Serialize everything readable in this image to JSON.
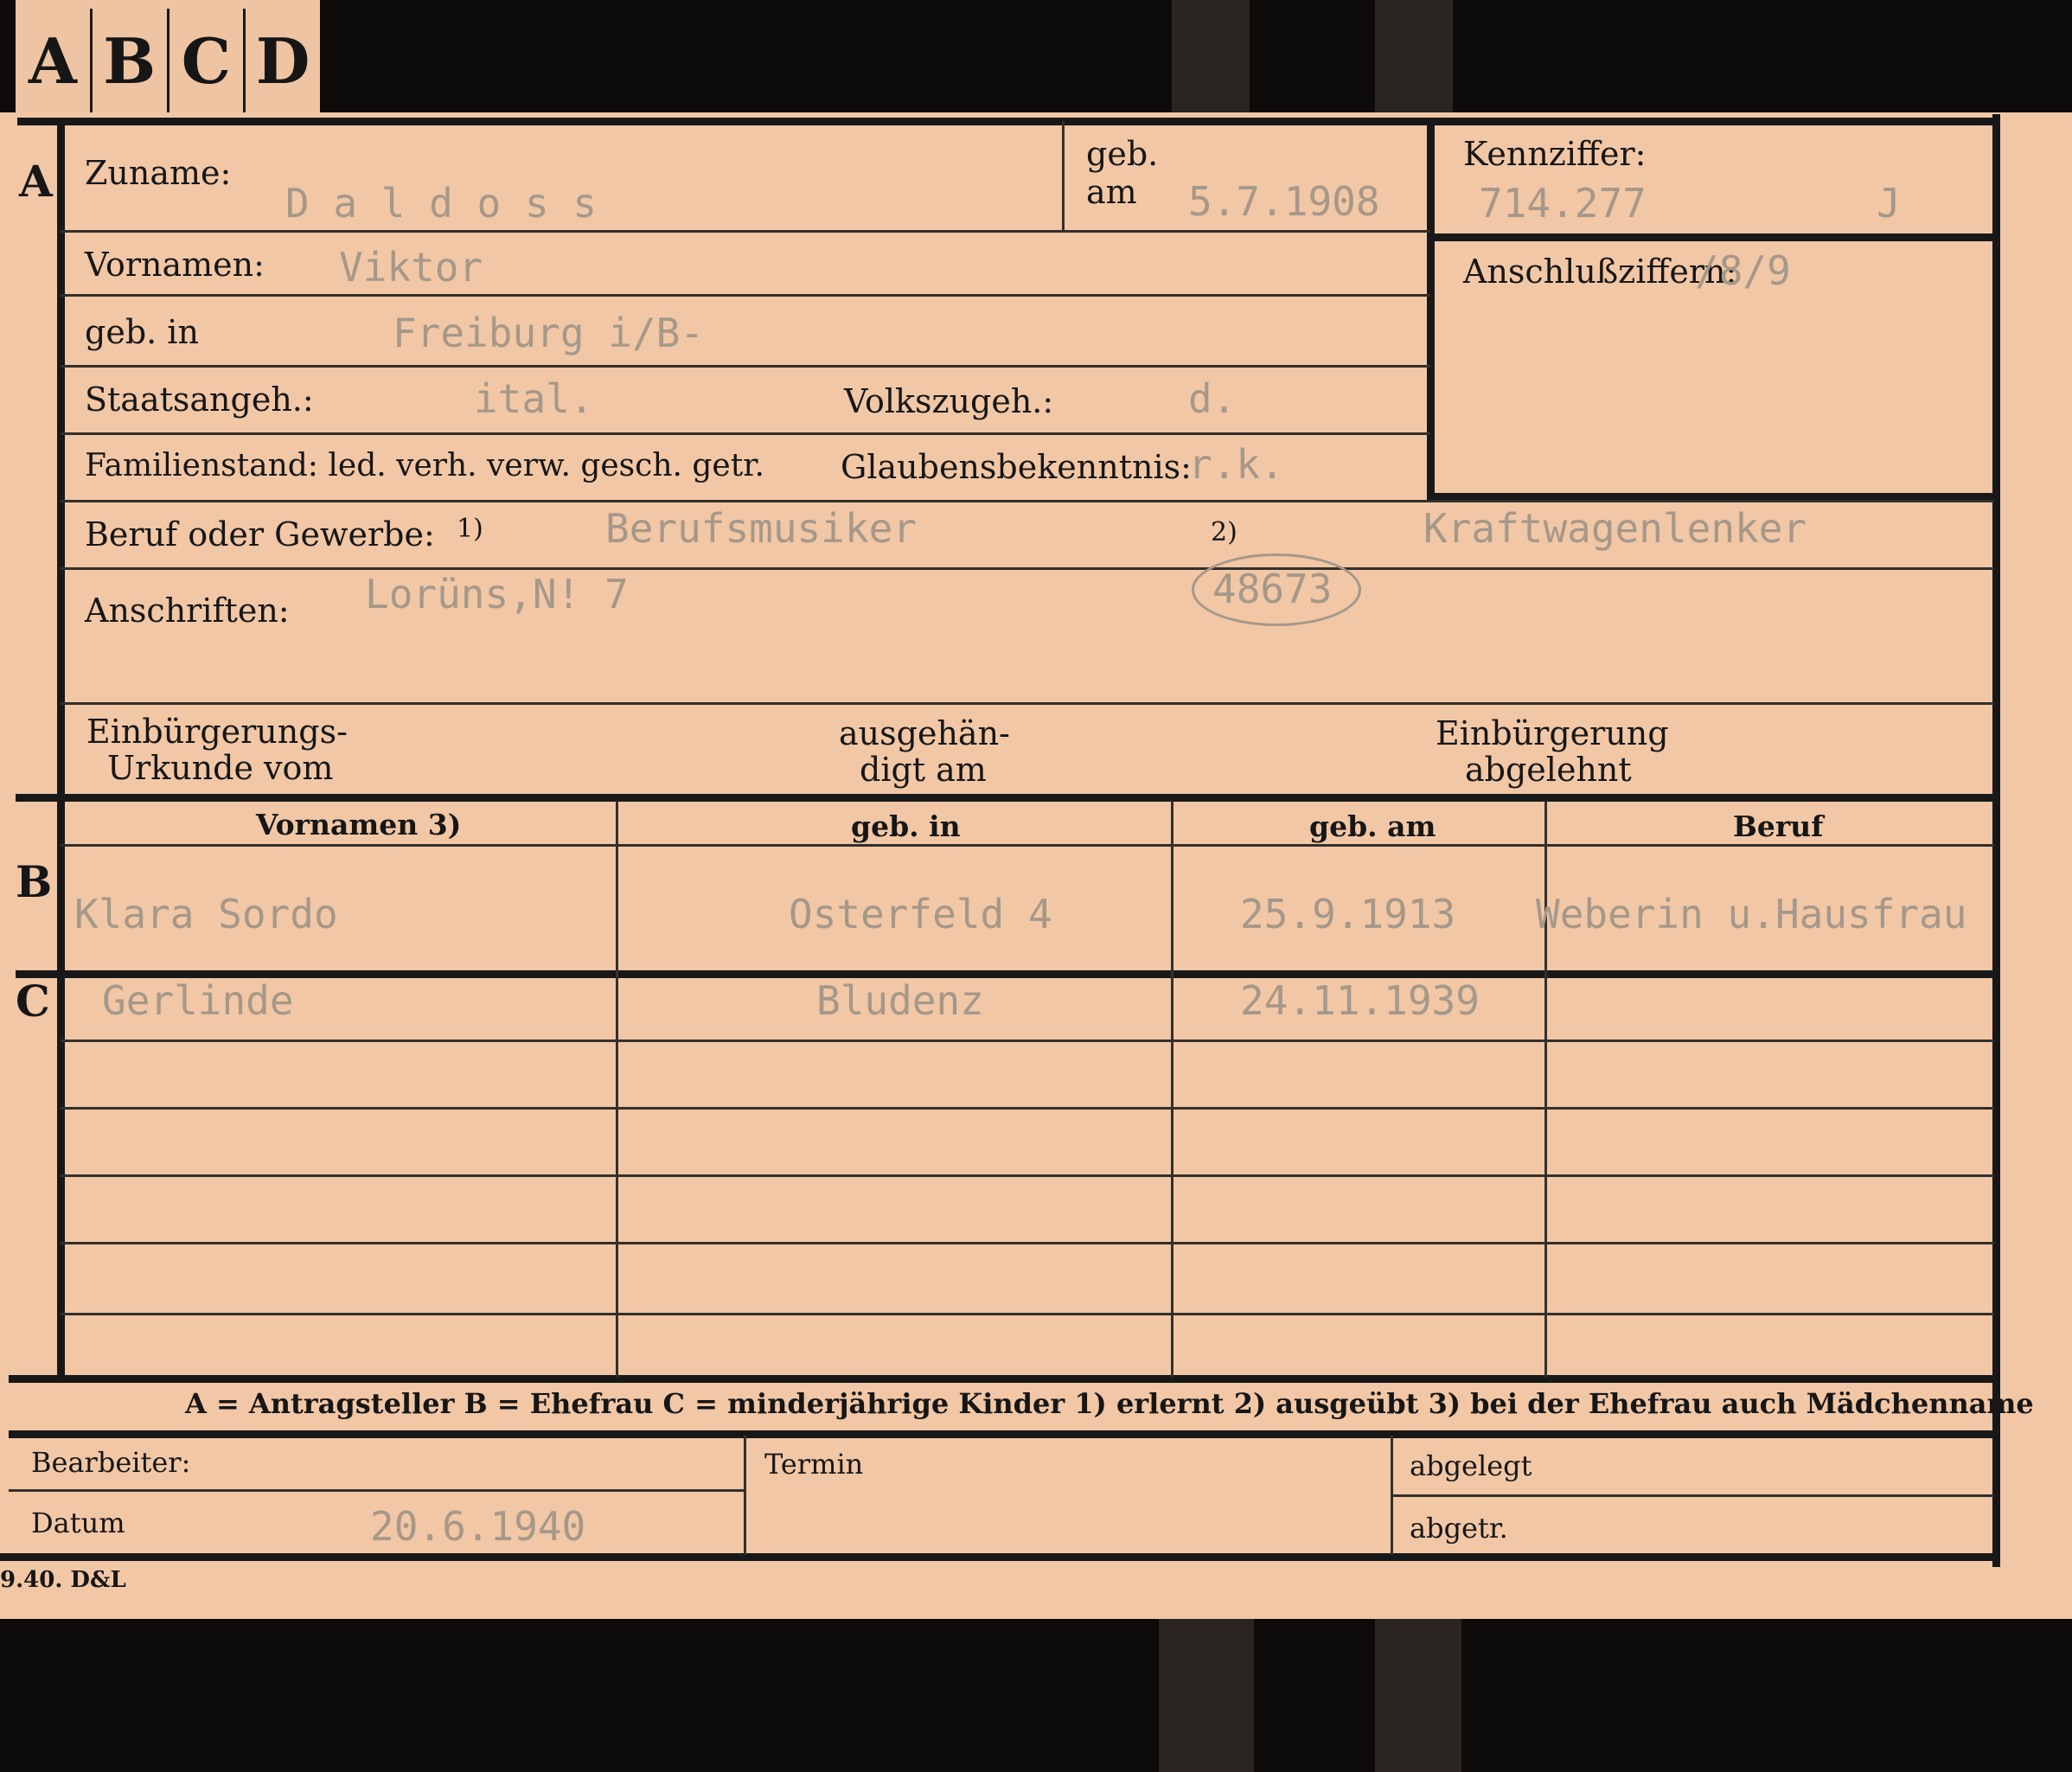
{
  "tabs": [
    "A",
    "B",
    "C",
    "D"
  ],
  "section_a": {
    "marker": "A",
    "zuname_label": "Zuname:",
    "zuname_value": "D a l d o s s",
    "geb_am_label_1": "geb.",
    "geb_am_label_2": "am",
    "geb_am_value": "5.7.1908",
    "kennziffer_label": "Kennziffer:",
    "kennziffer_value": "714.277",
    "kennziffer_suffix": "J",
    "anschluss_label": "Anschlußziffern:",
    "anschluss_value": "/8/9",
    "vornamen_label": "Vornamen:",
    "vornamen_value": "Viktor",
    "geb_in_label": "geb. in",
    "geb_in_value": "Freiburg i/B-",
    "staat_label": "Staatsangeh.:",
    "staat_value": "ital.",
    "volk_label": "Volkszugeh.:",
    "volk_value": "d.",
    "familienstand_label": "Familienstand: led. verh. verw. gesch. getr.",
    "glauben_label": "Glaubensbekenntnis:",
    "glauben_value": "r.k.",
    "beruf_label": "Beruf oder Gewerbe:",
    "beruf_note1": "1)",
    "beruf_value1": "Berufsmusiker",
    "beruf_note2": "2)",
    "beruf_value2": "Kraftwagenlenker",
    "anschrift_label": "Anschriften:",
    "anschrift_value": "Lorüns,N! 7",
    "anschrift_stamp": "48673",
    "einb_label_1": "Einbürgerungs-",
    "einb_label_2": "Urkunde vom",
    "ausgeh_label_1": "ausgehän-",
    "ausgeh_label_2": "digt am",
    "abgelehnt_label_1": "Einbürgerung",
    "abgelehnt_label_2": "abgelehnt"
  },
  "section_b": {
    "marker": "B",
    "columns": [
      "Vornamen 3)",
      "geb. in",
      "geb. am",
      "Beruf"
    ],
    "row": [
      "Klara Sordo",
      "Osterfeld 4",
      "25.9.1913",
      "Weberin u.Hausfrau"
    ]
  },
  "section_c": {
    "marker": "C",
    "row": [
      "Gerlinde",
      "Bludenz",
      "24.11.1939",
      ""
    ]
  },
  "legend": "A = Antragsteller   B = Ehefrau   C = minderjährige Kinder   1) erlernt   2) ausgeübt   3) bei der Ehefrau auch Mädchenname",
  "footer": {
    "bearbeiter_label": "Bearbeiter:",
    "datum_label": "Datum",
    "datum_value": "20.6.1940",
    "termin_label": "Termin",
    "abgelegt_label": "abgelegt",
    "abgetr_label": "abgetr."
  },
  "print_mark": "9.40. D&L"
}
